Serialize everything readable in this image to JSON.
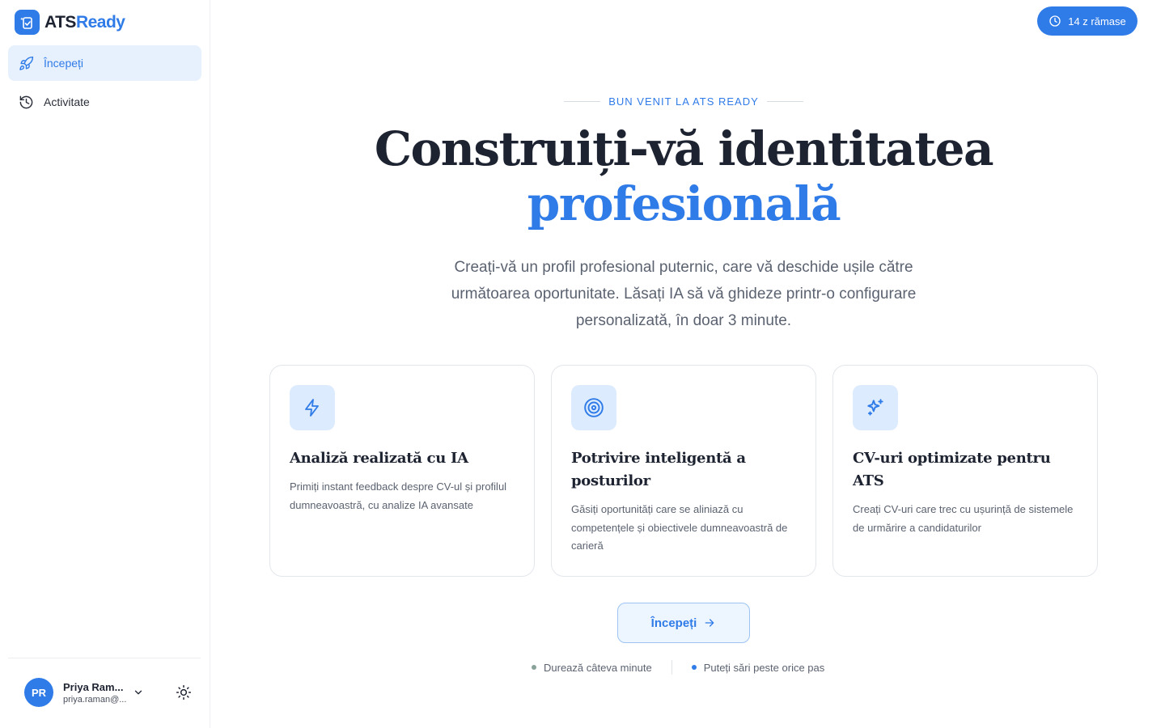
{
  "app": {
    "name_part1": "ATS",
    "name_part2": "Ready",
    "brand_color": "#2f7be8"
  },
  "sidebar": {
    "items": [
      {
        "label": "Începeți",
        "icon": "rocket-icon",
        "active": true
      },
      {
        "label": "Activitate",
        "icon": "history-icon",
        "active": false
      }
    ]
  },
  "user": {
    "initials": "PR",
    "name": "Priya Ram...",
    "email": "priya.raman@..."
  },
  "trial": {
    "label": "14 z rămase",
    "icon": "clock-icon"
  },
  "hero": {
    "eyebrow": "BUN VENIT LA ATS READY",
    "title_line1": "Construiți-vă identitatea",
    "title_line2": "profesională",
    "subtitle": "Creați-vă un profil profesional puternic, care vă deschide ușile către următoarea oportunitate. Lăsați IA să vă ghideze printr-o configurare personalizată, în doar 3 minute."
  },
  "features": [
    {
      "icon": "lightning-icon",
      "title": "Analiză realizată cu IA",
      "text": "Primiți instant feedback despre CV-ul și profilul dumneavoastră, cu analize IA avansate"
    },
    {
      "icon": "target-icon",
      "title": "Potrivire inteligentă a posturilor",
      "text": "Găsiți oportunități care se aliniază cu competențele și obiectivele dumneavoastră de carieră"
    },
    {
      "icon": "sparkles-icon",
      "title": "CV-uri optimizate pentru ATS",
      "text": "Creați CV-uri care trec cu ușurință de sistemele de urmărire a candidaturilor"
    }
  ],
  "cta": {
    "label": "Începeți"
  },
  "notes": [
    {
      "text": "Durează câteva minute",
      "dot_color": "#8aa39a"
    },
    {
      "text": "Puteți sări peste orice pas",
      "dot_color": "#2f7be8"
    }
  ]
}
